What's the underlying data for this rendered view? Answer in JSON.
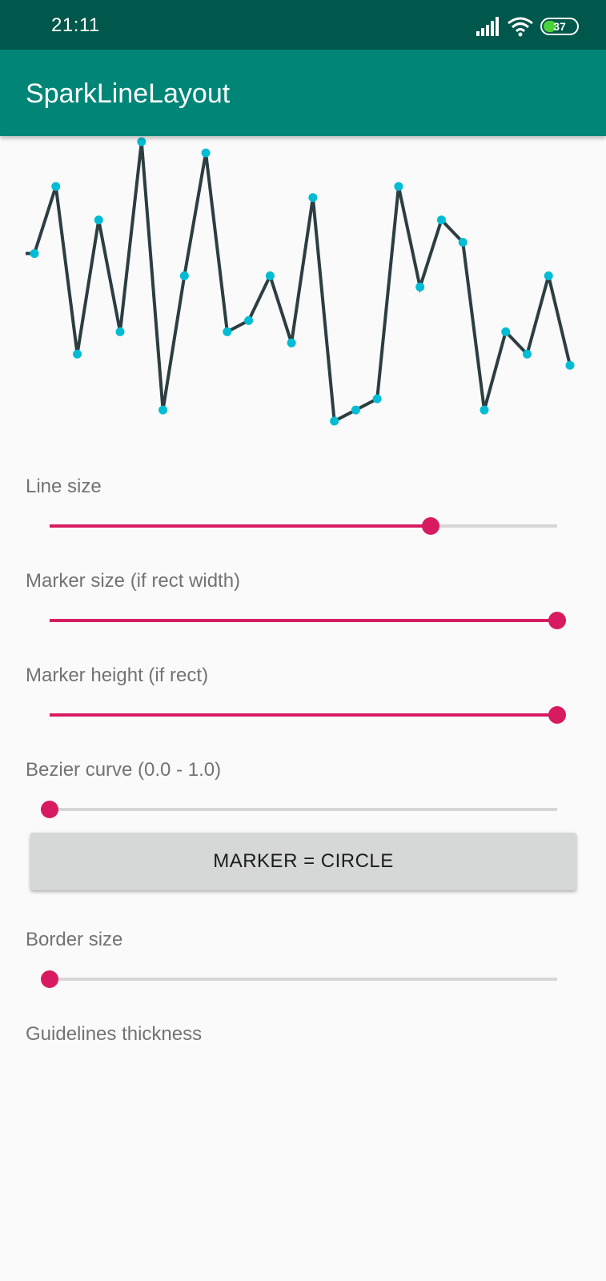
{
  "status_bar": {
    "time": "21:11",
    "icons": [
      "signal-icon",
      "wifi-icon",
      "battery-icon"
    ],
    "battery_level": "37"
  },
  "app_bar": {
    "title": "SparkLineLayout"
  },
  "colors": {
    "status_bar": "#00574b",
    "app_bar": "#008577",
    "line": "#2c3e42",
    "marker": "#00bcd4",
    "accent": "#d81b60",
    "track": "#d6d6d6"
  },
  "chart_data": {
    "type": "line",
    "values": [
      62,
      74,
      44,
      68,
      48,
      82,
      34,
      58,
      80,
      48,
      50,
      58,
      46,
      72,
      32,
      34,
      36,
      74,
      56,
      68,
      64,
      34,
      48,
      44,
      58,
      42
    ],
    "ylim": [
      30,
      83
    ],
    "marker": "circle",
    "grid": false
  },
  "controls": {
    "line_size": {
      "label": "Line size",
      "value": 0.75
    },
    "marker_size": {
      "label": "Marker size (if rect width)",
      "value": 1.0
    },
    "marker_height": {
      "label": "Marker height (if rect)",
      "value": 1.0
    },
    "bezier_curve": {
      "label": "Bezier curve (0.0 - 1.0)",
      "value": 0.0
    },
    "marker_button": {
      "label": "MARKER = CIRCLE"
    },
    "border_size": {
      "label": "Border size",
      "value": 0.0
    },
    "guidelines_thickness": {
      "label": "Guidelines thickness"
    }
  }
}
